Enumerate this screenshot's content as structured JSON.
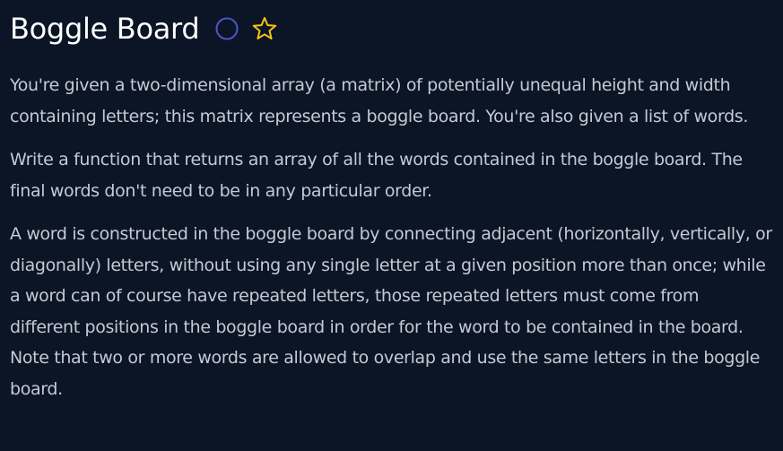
{
  "problem": {
    "title": "Boggle Board",
    "status_icon": "circle-status-icon",
    "favorite_icon": "star-icon",
    "colors": {
      "background": "#0b1525",
      "title": "#ffffff",
      "body_text": "#c3cad3",
      "status_circle": "#4a56c8",
      "star": "#f5c518"
    },
    "paragraphs": [
      "You're given a two-dimensional array (a matrix) of potentially unequal height and width containing letters; this matrix represents a boggle board. You're also given a list of words.",
      "Write a function that returns an array of all the words contained in the boggle board. The final words don't need to be in any particular order.",
      "A word is constructed in the boggle board by connecting adjacent (horizontally, vertically, or diagonally) letters, without using any single letter at a given position more than once; while a word can of course have repeated letters, those repeated letters must come from different positions in the boggle board in order for the word to be contained in the board. Note that two or more words are allowed to overlap and use the same letters in the boggle board."
    ]
  }
}
